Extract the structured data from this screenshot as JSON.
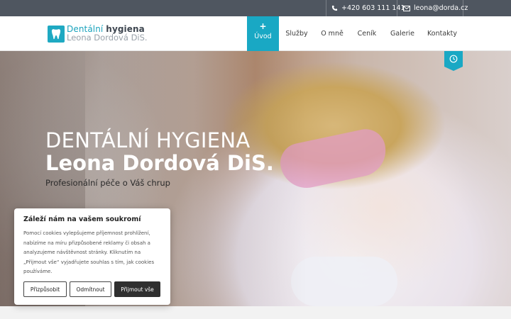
{
  "topbar": {
    "phone": "+420 603 111 141",
    "email": "leona@dorda.cz"
  },
  "logo": {
    "line1_a": "Dentální",
    "line1_b": "hygiena",
    "line2": "Leona Dordová DiS."
  },
  "nav": {
    "items": [
      {
        "label": "Úvod",
        "active": true
      },
      {
        "label": "Služby"
      },
      {
        "label": "O mně"
      },
      {
        "label": "Ceník"
      },
      {
        "label": "Galerie"
      },
      {
        "label": "Kontakty"
      }
    ],
    "active_icon": "+"
  },
  "hero": {
    "title_line1": "DENTÁLNÍ HYGIENA",
    "title_line2": "Leona Dordová DiS.",
    "subtitle": "Profesionální péče o Váš chrup"
  },
  "cookie": {
    "title": "Záleží nám na vašem soukromí",
    "text": "Pomocí cookies vylepšujeme příjemnost prohlížení, nabízíme na míru přizpůsobené reklamy či obsah a analyzujeme návštěvnost stránky. Kliknutím na „Přijmout vše“ vyjadřujete souhlas s tím, jak cookies používáme.",
    "customize": "Přizpůsobit",
    "reject": "Odmítnout",
    "accept": "Přijmout vše"
  },
  "colors": {
    "accent": "#19a8c4",
    "topbar": "#4f5660"
  },
  "icons": [
    "phone-icon",
    "mail-icon",
    "tooth-icon",
    "clock-icon"
  ]
}
